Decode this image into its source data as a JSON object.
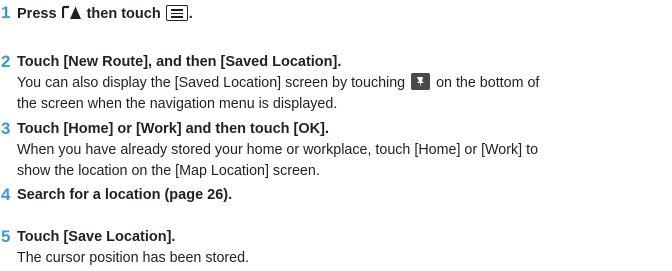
{
  "steps": [
    {
      "number": "1",
      "head_before": "Press ",
      "head_middle": " then touch ",
      "head_after": "."
    },
    {
      "number": "2",
      "head": "Touch [New Route], and then [Saved Location].",
      "desc_line1_before": "You can also display the [Saved Location] screen by touching ",
      "desc_line1_after": " on the bottom of",
      "desc_line2": "the screen when the navigation menu is displayed."
    },
    {
      "number": "3",
      "head": "Touch [Home] or [Work] and then touch [OK].",
      "desc_line1": "When you have already stored your home or workplace, touch [Home] or [Work] to",
      "desc_line2": "show the location on the [Map Location] screen."
    },
    {
      "number": "4",
      "head": "Search for a location (page 26)."
    },
    {
      "number": "5",
      "head": "Touch [Save Location].",
      "desc_line1": "The cursor position has been stored."
    }
  ],
  "icons": {
    "nav": "navigation-button-icon",
    "menu": "menu-icon",
    "saved": "saved-location-pin-icon"
  },
  "colors": {
    "step_number": "#3a9bcf",
    "text": "#231f20"
  }
}
